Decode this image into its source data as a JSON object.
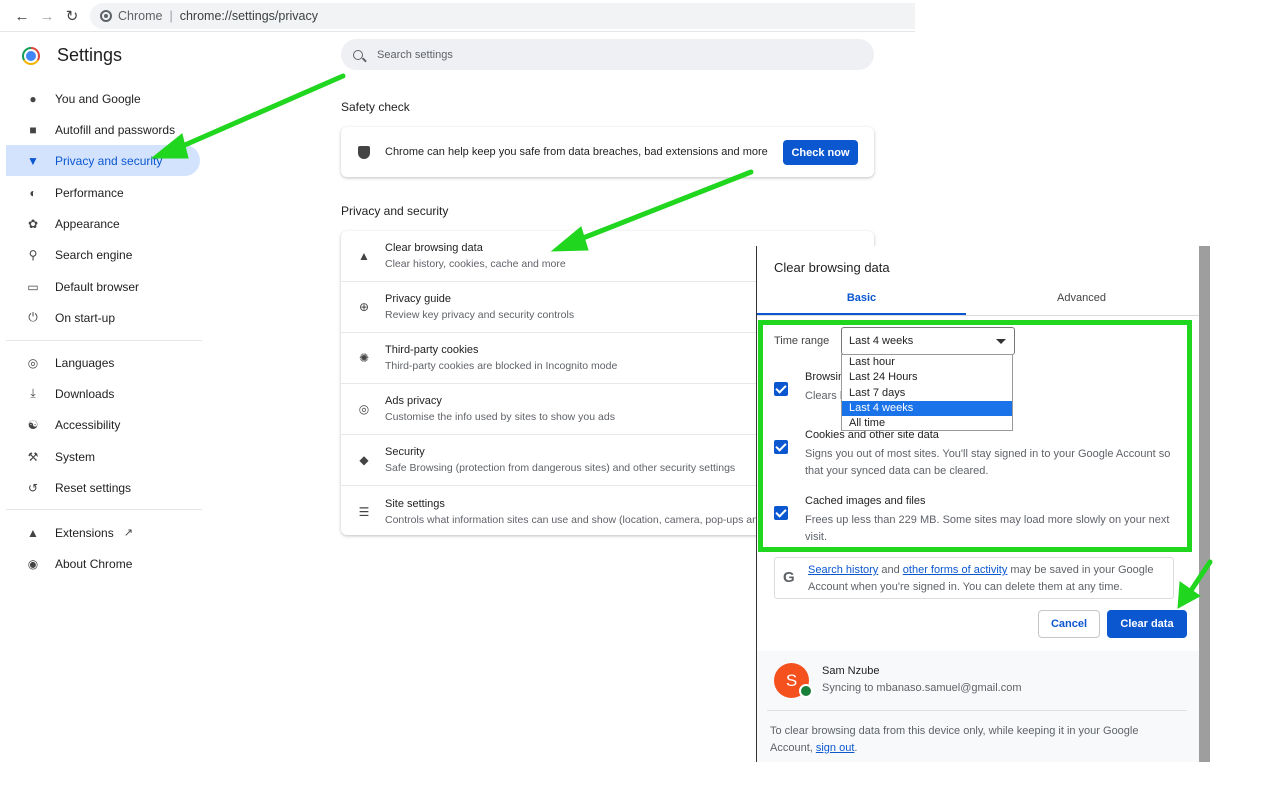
{
  "browser": {
    "site_label": "Chrome",
    "url": "chrome://settings/privacy"
  },
  "sidebar": {
    "title": "Settings",
    "items": [
      {
        "label": "You and Google",
        "icon": "person-icon"
      },
      {
        "label": "Autofill and passwords",
        "icon": "clipboard-icon"
      },
      {
        "label": "Privacy and security",
        "icon": "shield-icon",
        "active": true
      },
      {
        "label": "Performance",
        "icon": "gauge-icon"
      },
      {
        "label": "Appearance",
        "icon": "palette-icon"
      },
      {
        "label": "Search engine",
        "icon": "search-icon"
      },
      {
        "label": "Default browser",
        "icon": "browser-icon"
      },
      {
        "label": "On start-up",
        "icon": "power-icon"
      },
      {
        "label": "Languages",
        "icon": "globe-icon"
      },
      {
        "label": "Downloads",
        "icon": "download-icon"
      },
      {
        "label": "Accessibility",
        "icon": "accessibility-icon"
      },
      {
        "label": "System",
        "icon": "wrench-icon"
      },
      {
        "label": "Reset settings",
        "icon": "history-icon"
      },
      {
        "label": "Extensions",
        "icon": "puzzle-icon"
      },
      {
        "label": "About Chrome",
        "icon": "chrome-icon"
      }
    ]
  },
  "search": {
    "placeholder": "Search settings"
  },
  "safety_check": {
    "heading": "Safety check",
    "text": "Chrome can help keep you safe from data breaches, bad extensions and more",
    "button": "Check now"
  },
  "privacy": {
    "heading": "Privacy and security",
    "rows": [
      {
        "title": "Clear browsing data",
        "desc": "Clear history, cookies, cache and more",
        "icon": "trash-icon"
      },
      {
        "title": "Privacy guide",
        "desc": "Review key privacy and security controls",
        "icon": "compass-icon"
      },
      {
        "title": "Third-party cookies",
        "desc": "Third-party cookies are blocked in Incognito mode",
        "icon": "cookie-icon"
      },
      {
        "title": "Ads privacy",
        "desc": "Customise the info used by sites to show you ads",
        "icon": "ads-icon"
      },
      {
        "title": "Security",
        "desc": "Safe Browsing (protection from dangerous sites) and other security settings",
        "icon": "security-shield-icon"
      },
      {
        "title": "Site settings",
        "desc": "Controls what information sites can use and show (location, camera, pop-ups and o",
        "icon": "sliders-icon"
      }
    ]
  },
  "dialog": {
    "title": "Clear browsing data",
    "tabs": [
      "Basic",
      "Advanced"
    ],
    "time_range_label": "Time range",
    "time_range_value": "Last 4 weeks",
    "options": [
      "Last hour",
      "Last 24 Hours",
      "Last 7 days",
      "Last 4 weeks",
      "All time"
    ],
    "selected_option": 3,
    "items": [
      {
        "title": "Browsing h",
        "desc": "Clears h",
        "checked": true
      },
      {
        "title": "Cookies and other site data",
        "desc": "Signs you out of most sites. You'll stay signed in to your Google Account so that your synced data can be cleared.",
        "checked": true
      },
      {
        "title": "Cached images and files",
        "desc": "Frees up less than 229 MB. Some sites may load more slowly on your next visit.",
        "checked": true
      }
    ],
    "google_note": {
      "link1": "Search history",
      "mid": " and ",
      "link2": "other forms of activity",
      "rest": " may be saved in your Google Account when you're signed in. You can delete them at any time."
    },
    "cancel": "Cancel",
    "clear": "Clear data",
    "account": {
      "initial": "S",
      "name": "Sam Nzube",
      "email": "Syncing to mbanaso.samuel@gmail.com"
    },
    "signout_note": {
      "text": "To clear browsing data from this device only, while keeping it in your Google Account, ",
      "link": "sign out",
      "end": "."
    }
  },
  "colors": {
    "accent": "#0b57d0",
    "highlight": "#21d61f",
    "avatar": "#f4511e"
  }
}
